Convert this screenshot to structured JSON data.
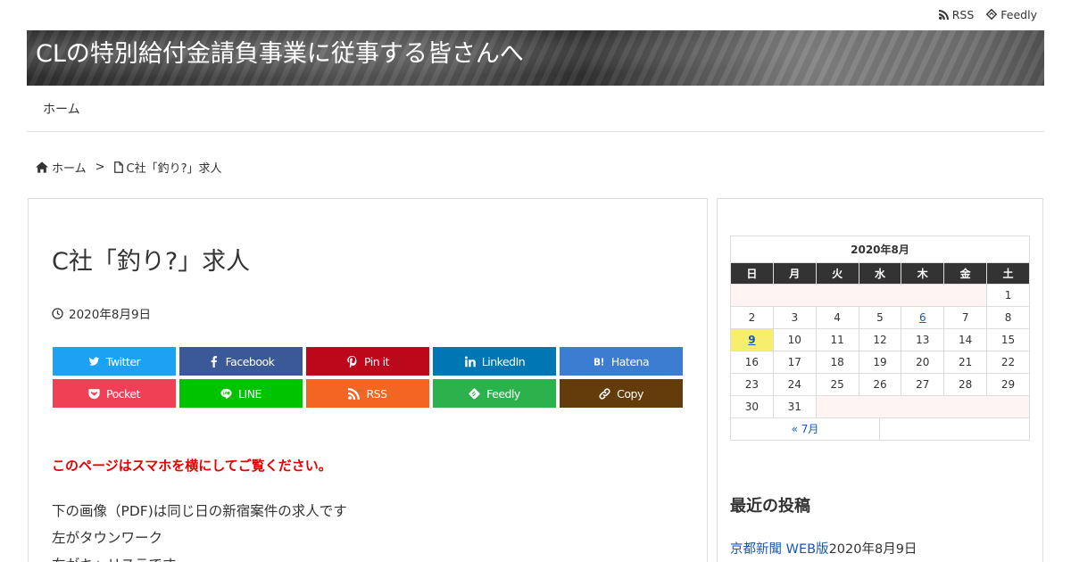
{
  "topbar": {
    "rss_label": "RSS",
    "feedly_label": "Feedly"
  },
  "header": {
    "site_title": "CLの特別給付金請負事業に従事する皆さんへ"
  },
  "nav": {
    "home": "ホーム"
  },
  "breadcrumb": {
    "home": "ホーム",
    "separator": ">",
    "current": "C社「釣り?」求人"
  },
  "article": {
    "title": "C社「釣り?」求人",
    "date": "2020年8月9日",
    "notice": "このページはスマホを横にしてご覧ください。",
    "lines": [
      "下の画像（PDF)は同じ日の新宿案件の求人です",
      "左がタウンワーク",
      "右がキャリステです"
    ]
  },
  "share": [
    {
      "label": "Twitter",
      "color": "#1da1f2",
      "icon": "twitter-icon"
    },
    {
      "label": "Facebook",
      "color": "#3b5998",
      "icon": "facebook-icon"
    },
    {
      "label": "Pin it",
      "color": "#bd081c",
      "icon": "pinterest-icon"
    },
    {
      "label": "LinkedIn",
      "color": "#0077b5",
      "icon": "linkedin-icon"
    },
    {
      "label": "Hatena",
      "color": "#3c7dd1",
      "icon": "hatena-icon"
    },
    {
      "label": "Pocket",
      "color": "#ef4056",
      "icon": "pocket-icon"
    },
    {
      "label": "LINE",
      "color": "#00c300",
      "icon": "line-icon"
    },
    {
      "label": "RSS",
      "color": "#f26522",
      "icon": "rss-icon"
    },
    {
      "label": "Feedly",
      "color": "#2bb24c",
      "icon": "feedly-icon"
    },
    {
      "label": "Copy",
      "color": "#643c0b",
      "icon": "link-icon"
    }
  ],
  "calendar": {
    "caption": "2020年8月",
    "weekdays": [
      "日",
      "月",
      "火",
      "水",
      "木",
      "金",
      "土"
    ],
    "weeks": [
      [
        "",
        "",
        "",
        "",
        "",
        "",
        "1"
      ],
      [
        "2",
        "3",
        "4",
        "5",
        "6",
        "7",
        "8"
      ],
      [
        "9",
        "10",
        "11",
        "12",
        "13",
        "14",
        "15"
      ],
      [
        "16",
        "17",
        "18",
        "19",
        "20",
        "21",
        "22"
      ],
      [
        "23",
        "24",
        "25",
        "26",
        "27",
        "28",
        "29"
      ],
      [
        "30",
        "31",
        "",
        "",
        "",
        "",
        ""
      ]
    ],
    "linked_days": [
      "6",
      "9"
    ],
    "today": "9",
    "prev_label": "« 7月"
  },
  "sidebar": {
    "recent_title": "最近の投稿",
    "recent_link": "京都新聞 WEB版",
    "recent_date": "2020年8月9日"
  },
  "colors": {
    "accent_link": "#1a58b6",
    "notice_red": "#e60000",
    "calendar_header": "#333333",
    "today_highlight": "#f7ef6b"
  }
}
